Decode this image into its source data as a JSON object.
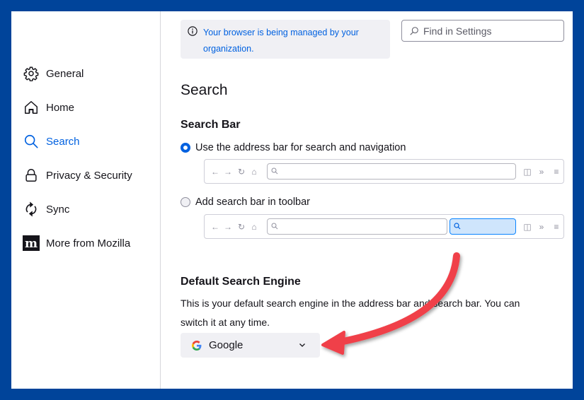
{
  "sidebar": {
    "items": [
      {
        "label": "General",
        "icon": "gear-icon",
        "active": false
      },
      {
        "label": "Home",
        "icon": "home-icon",
        "active": false
      },
      {
        "label": "Search",
        "icon": "search-icon",
        "active": true
      },
      {
        "label": "Privacy & Security",
        "icon": "lock-icon",
        "active": false
      },
      {
        "label": "Sync",
        "icon": "sync-icon",
        "active": false
      },
      {
        "label": "More from Mozilla",
        "icon": "mozilla-icon",
        "active": false
      }
    ]
  },
  "notice": {
    "line1": "Your browser is being managed by your",
    "line2": "organization.",
    "icon": "info-icon"
  },
  "find": {
    "placeholder": "Find in Settings",
    "icon": "search-icon"
  },
  "page": {
    "title": "Search",
    "search_bar": {
      "heading": "Search Bar",
      "options": [
        {
          "label": "Use the address bar for search and navigation",
          "selected": true
        },
        {
          "label": "Add search bar in toolbar",
          "selected": false
        }
      ]
    },
    "default_engine": {
      "heading": "Default Search Engine",
      "description_line1": "This is your default search engine in the address bar and search bar. You can",
      "description_line2": "switch it at any time.",
      "selected": "Google",
      "engine_icon": "google-icon"
    }
  },
  "colors": {
    "frame": "#00449a",
    "accent": "#0061e0",
    "annotation_arrow": "#f0404a",
    "panel_bg": "#f0f0f4"
  }
}
